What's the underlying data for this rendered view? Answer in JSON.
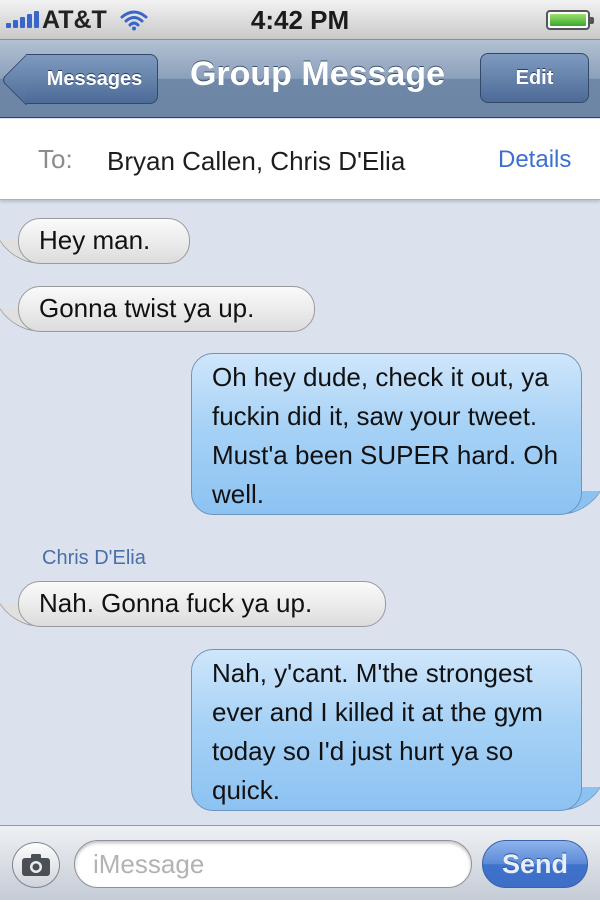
{
  "status_bar": {
    "carrier": "AT&T",
    "time": "4:42 PM",
    "signal_icon": "signal-bars-icon",
    "wifi_icon": "wifi-icon",
    "battery_icon": "battery-icon",
    "battery_level": 1.0
  },
  "nav": {
    "back_label": "Messages",
    "title": "Group Message",
    "edit_label": "Edit"
  },
  "recipients": {
    "to_label": "To:",
    "names": "Bryan Callen, Chris D'Elia",
    "details_label": "Details"
  },
  "messages": [
    {
      "direction": "incoming",
      "text": "Hey man."
    },
    {
      "direction": "incoming",
      "text": "Gonna twist ya up."
    },
    {
      "direction": "outgoing",
      "text": "Oh hey dude, check it out, ya fuckin did it, saw your tweet. Must'a been SUPER hard. Oh well."
    },
    {
      "direction": "incoming",
      "sender": "Chris D'Elia",
      "text": "Nah. Gonna fuck ya up."
    },
    {
      "direction": "outgoing",
      "text": "Nah, y'cant. M'the strongest ever and I killed it at the gym today so I'd just hurt ya so quick."
    }
  ],
  "input": {
    "placeholder": "iMessage",
    "send_label": "Send",
    "camera_icon": "camera-icon"
  },
  "colors": {
    "nav_blue": "#6f88a8",
    "outgoing_bubble": "#a7d2f6",
    "incoming_bubble": "#ececec",
    "send_button": "#4f80d2",
    "link_blue": "#3d6ed2"
  }
}
